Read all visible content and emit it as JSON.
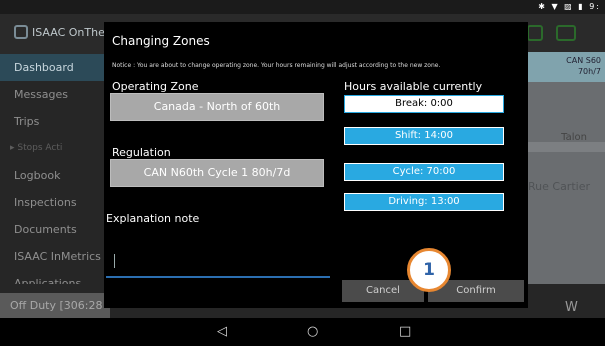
{
  "status_bar": {
    "icons": "✱ ▼ ▨ ▮ 9:"
  },
  "app": {
    "logo_text": "ISAAC OnTheG",
    "sidebar": [
      {
        "label": "Dashboard",
        "active": true
      },
      {
        "label": "Messages",
        "active": false
      },
      {
        "label": "Trips",
        "active": false
      },
      {
        "label": "▸  Stops   Acti",
        "sub": true
      },
      {
        "label": "Logbook",
        "active": false
      },
      {
        "label": "Inspections",
        "active": false
      },
      {
        "label": "Documents",
        "active": false
      },
      {
        "label": "ISAAC InMetrics",
        "active": false
      },
      {
        "label": "Applications",
        "active": false
      }
    ],
    "zone_card": {
      "line1": "CAN S60",
      "line2": "70h/7"
    },
    "map": {
      "label_talon": "Talon",
      "label_street": "Rue Cartier"
    },
    "off_duty": "Off Duty [306:28",
    "bottom_letter": "W"
  },
  "dialog": {
    "title": "Changing Zones",
    "notice": "Notice : You are about to change operating zone. Your hours remaining will adjust according to the new zone.",
    "operating_zone_label": "Operating Zone",
    "operating_zone_value": "Canada - North of 60th",
    "regulation_label": "Regulation",
    "regulation_value": "CAN N60th Cycle 1 80h/7d",
    "explanation_label": "Explanation note",
    "explanation_value": "",
    "hours_label": "Hours available currently",
    "break": "Break: 0:00",
    "shift": "Shift: 14:00",
    "cycle": "Cycle: 70:00",
    "driving": "Driving: 13:00",
    "cancel": "Cancel",
    "confirm": "Confirm"
  },
  "callout_number": "1",
  "navbar": {
    "back": "◁",
    "home": "○",
    "recent": "□"
  },
  "colors": {
    "accent_blue": "#29a9e1",
    "callout_border": "#e78731"
  }
}
